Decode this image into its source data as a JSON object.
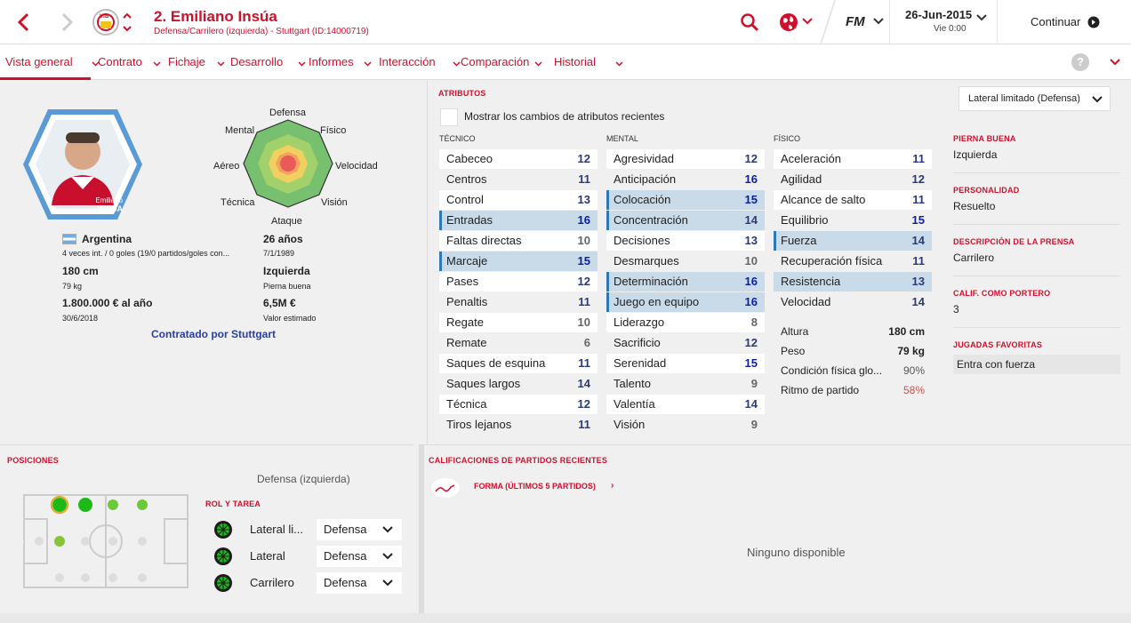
{
  "header": {
    "player_title": "2. Emiliano Insúa",
    "subtitle": "Defensa/Carrilero (izquierda) - Stuttgart (ID:14000719)",
    "date": "26-Jun-2015",
    "day_time": "Vie 0:00",
    "continue_label": "Continuar",
    "fm_label": "FM",
    "club_badge_text": "VfB"
  },
  "nav": {
    "tabs": [
      "Vista general",
      "Contrato",
      "Fichaje",
      "Desarrollo",
      "Informes",
      "Interacción",
      "Comparación",
      "Historial"
    ]
  },
  "profile": {
    "card_name_line1": "Emiliano",
    "card_name_line2": "INSUA",
    "radar_labels": {
      "top": "Defensa",
      "tr": "Físico",
      "r": "Velocidad",
      "br": "Visión",
      "bottom": "Ataque",
      "bl": "Técnica",
      "l": "Aéreo",
      "tl": "Mental"
    },
    "nationality": "Argentina",
    "caps": "4 veces int. / 0 goles (19/0 partidos/goles con...",
    "age": "26 años",
    "dob": "7/1/1989",
    "height": "180 cm",
    "weight": "79 kg",
    "foot": "Izquierda",
    "foot_label": "Pierna buena",
    "wage": "1.800.000 € al año",
    "contract_end": "30/6/2018",
    "value": "6,5M €",
    "value_label": "Valor estimado",
    "contracted_by": "Contratado por Stuttgart"
  },
  "attributes": {
    "section_title": "ATRIBUTOS",
    "role_select": "Lateral limitado (Defensa)",
    "show_changes": "Mostrar los cambios de atributos recientes",
    "technical_header": "TÉCNICO",
    "mental_header": "MENTAL",
    "physical_header": "FÍSICO",
    "technical": [
      {
        "n": "Cabeceo",
        "v": "12"
      },
      {
        "n": "Centros",
        "v": "11"
      },
      {
        "n": "Control",
        "v": "13"
      },
      {
        "n": "Entradas",
        "v": "16"
      },
      {
        "n": "Faltas directas",
        "v": "10"
      },
      {
        "n": "Marcaje",
        "v": "15"
      },
      {
        "n": "Pases",
        "v": "12"
      },
      {
        "n": "Penaltis",
        "v": "11"
      },
      {
        "n": "Regate",
        "v": "10"
      },
      {
        "n": "Remate",
        "v": "6"
      },
      {
        "n": "Saques de esquina",
        "v": "11"
      },
      {
        "n": "Saques largos",
        "v": "14"
      },
      {
        "n": "Técnica",
        "v": "12"
      },
      {
        "n": "Tiros lejanos",
        "v": "11"
      }
    ],
    "mental": [
      {
        "n": "Agresividad",
        "v": "12"
      },
      {
        "n": "Anticipación",
        "v": "16"
      },
      {
        "n": "Colocación",
        "v": "15"
      },
      {
        "n": "Concentración",
        "v": "14"
      },
      {
        "n": "Decisiones",
        "v": "13"
      },
      {
        "n": "Desmarques",
        "v": "10"
      },
      {
        "n": "Determinación",
        "v": "16"
      },
      {
        "n": "Juego en equipo",
        "v": "16"
      },
      {
        "n": "Liderazgo",
        "v": "8"
      },
      {
        "n": "Sacrificio",
        "v": "12"
      },
      {
        "n": "Serenidad",
        "v": "15"
      },
      {
        "n": "Talento",
        "v": "9"
      },
      {
        "n": "Valentía",
        "v": "14"
      },
      {
        "n": "Visión",
        "v": "9"
      }
    ],
    "physical": [
      {
        "n": "Aceleración",
        "v": "11"
      },
      {
        "n": "Agilidad",
        "v": "12"
      },
      {
        "n": "Alcance de salto",
        "v": "11"
      },
      {
        "n": "Equilibrio",
        "v": "15"
      },
      {
        "n": "Fuerza",
        "v": "14"
      },
      {
        "n": "Recuperación física",
        "v": "11"
      },
      {
        "n": "Resistencia",
        "v": "13"
      },
      {
        "n": "Velocidad",
        "v": "14"
      }
    ],
    "extra": [
      {
        "n": "Altura",
        "v": "180 cm"
      },
      {
        "n": "Peso",
        "v": "79 kg"
      },
      {
        "n": "Condición física glo...",
        "v": "90%"
      },
      {
        "n": "Ritmo de partido",
        "v": "58%"
      }
    ]
  },
  "side": {
    "foot_h": "PIERNA BUENA",
    "foot_v": "Izquierda",
    "pers_h": "PERSONALIDAD",
    "pers_v": "Resuelto",
    "press_h": "DESCRIPCIÓN DE LA PRENSA",
    "press_v": "Carrilero",
    "gk_h": "CALIF. COMO PORTERO",
    "gk_v": "3",
    "ppm_h": "JUGADAS FAVORITAS",
    "ppm_v": "Entra con fuerza"
  },
  "positions": {
    "title": "POSICIONES",
    "current": "Defensa (izquierda)",
    "roles_title": "ROL Y TAREA",
    "roles": [
      {
        "role": "Lateral li...",
        "duty": "Defensa"
      },
      {
        "role": "Lateral",
        "duty": "Defensa"
      },
      {
        "role": "Carrilero",
        "duty": "Defensa"
      }
    ]
  },
  "ratings": {
    "title": "CALIFICACIONES DE PARTIDOS RECIENTES",
    "form": "FORMA (ÚLTIMOS 5 PARTIDOS)",
    "empty": "Ninguno disponible"
  }
}
